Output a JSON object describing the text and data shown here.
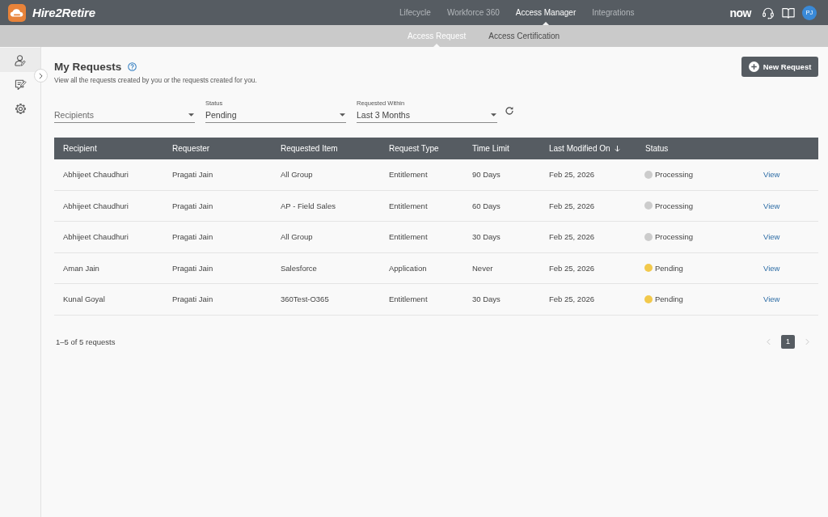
{
  "app": {
    "name": "Hire2Retire"
  },
  "nav": {
    "tabs": [
      {
        "label": "Lifecycle",
        "selected": false
      },
      {
        "label": "Workforce 360",
        "selected": false
      },
      {
        "label": "Access Manager",
        "selected": true
      },
      {
        "label": "Integrations",
        "selected": false
      }
    ]
  },
  "header_right": {
    "logo_text": "now",
    "avatar": "PJ"
  },
  "subnav": {
    "tabs": [
      {
        "label": "Access Request",
        "selected": true
      },
      {
        "label": "Access Certification",
        "selected": false
      }
    ]
  },
  "sidebar": {
    "expanded": false,
    "items": [
      {
        "selected": true
      },
      {
        "selected": false
      },
      {
        "selected": false
      }
    ]
  },
  "page": {
    "title": "My Requests",
    "subtitle": "View all the requests created by you or the requests created for you.",
    "new_button": "New Request"
  },
  "filters": [
    {
      "placeholder": "Recipients"
    },
    {
      "label": "Status",
      "value": "Pending"
    },
    {
      "label": "Requested Within",
      "value": "Last 3 Months"
    }
  ],
  "table": {
    "columns": [
      {
        "label": "Recipient",
        "sorted": false
      },
      {
        "label": "Requester",
        "sorted": false
      },
      {
        "label": "Requested Item",
        "sorted": false
      },
      {
        "label": "Request Type",
        "sorted": false
      },
      {
        "label": "Time Limit",
        "sorted": false
      },
      {
        "label": "Last Modified On",
        "sorted": true
      },
      {
        "label": "Status",
        "sorted": false
      }
    ],
    "rows": [
      {
        "cells": [
          "Abhijeet Chaudhuri",
          "Pragati Jain",
          "All Group",
          "Entitlement",
          "90 Days",
          "Feb 25, 2026"
        ],
        "status": {
          "label": "Processing",
          "color": "#cccccc"
        },
        "action": "View"
      },
      {
        "cells": [
          "Abhijeet Chaudhuri",
          "Pragati Jain",
          "AP - Field Sales",
          "Entitlement",
          "60 Days",
          "Feb 25, 2026"
        ],
        "status": {
          "label": "Processing",
          "color": "#cccccc"
        },
        "action": "View"
      },
      {
        "cells": [
          "Abhijeet Chaudhuri",
          "Pragati Jain",
          "All Group",
          "Entitlement",
          "30 Days",
          "Feb 25, 2026"
        ],
        "status": {
          "label": "Processing",
          "color": "#cccccc"
        },
        "action": "View"
      },
      {
        "cells": [
          "Aman Jain",
          "Pragati Jain",
          "Salesforce",
          "Application",
          "Never",
          "Feb 25, 2026"
        ],
        "status": {
          "label": "Pending",
          "color": "#f2c94c"
        },
        "action": "View"
      },
      {
        "cells": [
          "Kunal Goyal",
          "Pragati Jain",
          "360Test-O365",
          "Entitlement",
          "30 Days",
          "Feb 25, 2026"
        ],
        "status": {
          "label": "Pending",
          "color": "#f2c94c"
        },
        "action": "View"
      }
    ]
  },
  "footer": {
    "summary": "1–5 of 5 requests",
    "pagination": {
      "prev_disabled": true,
      "pages": [
        {
          "label": "1",
          "selected": true
        }
      ],
      "next_disabled": true
    }
  }
}
